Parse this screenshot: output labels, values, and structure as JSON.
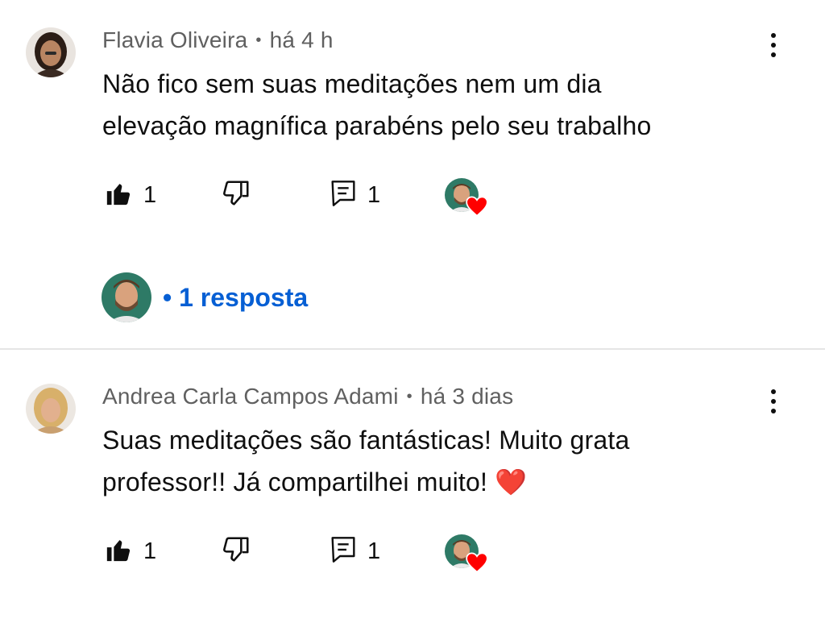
{
  "comments": [
    {
      "author": "Flavia Oliveira",
      "time": "há 4 h",
      "text_line1": "Não fico sem suas meditações nem um dia",
      "text_line2": "elevação magnífica parabéns pelo seu trabalho",
      "likes": "1",
      "replies_count": "1",
      "replies_label": "• 1 resposta"
    },
    {
      "author": "Andrea Carla Campos Adami",
      "time": "há 3 dias",
      "text_line1": "Suas meditações são fantásticas! Muito grata",
      "text_line2": "professor!! Já compartilhei muito! ❤️",
      "likes": "1",
      "replies_count": "1"
    }
  ],
  "separator": "•",
  "colors": {
    "link": "#065fd4",
    "meta": "#606060",
    "heart": "#ff0000",
    "divider": "#e5e5e5"
  },
  "icons": [
    "like-filled-icon",
    "dislike-icon",
    "reply-icon",
    "more-vert-icon",
    "heart-icon"
  ]
}
